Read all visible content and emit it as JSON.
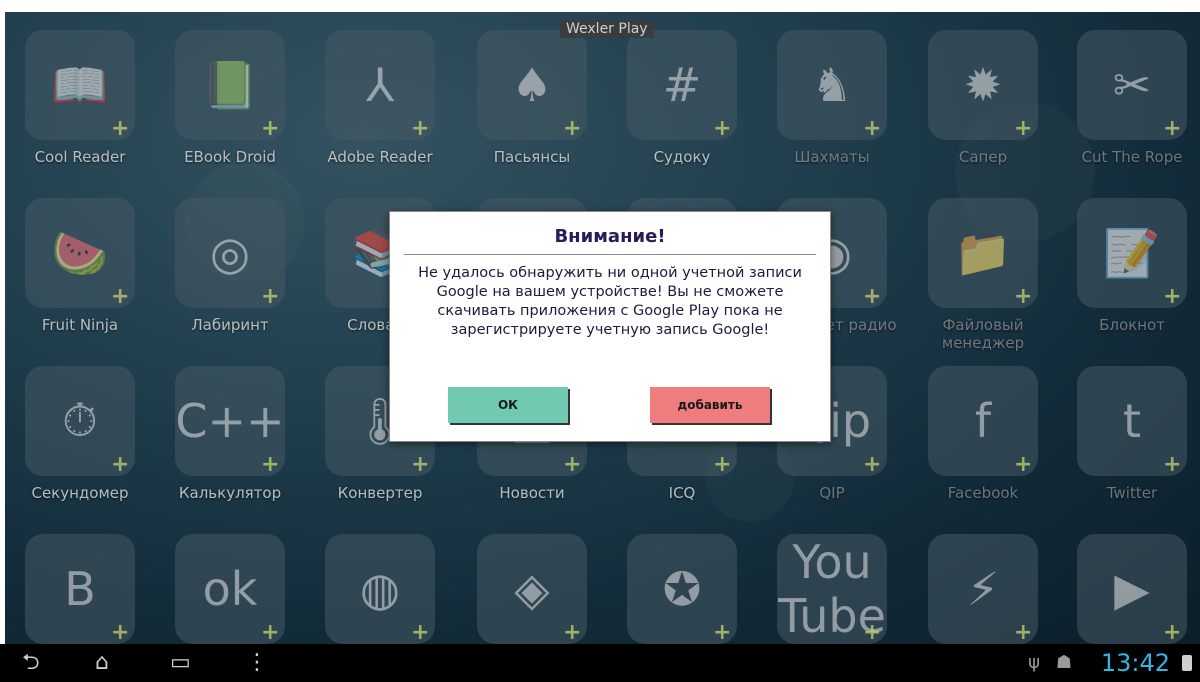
{
  "window": {
    "title": "Wexler Play"
  },
  "apps": [
    {
      "label": "Cool Reader",
      "glyph": "📖",
      "icon": "book-icon"
    },
    {
      "label": "EBook Droid",
      "glyph": "📗",
      "icon": "ebook-icon"
    },
    {
      "label": "Adobe Reader",
      "glyph": "⅄",
      "icon": "pdf-icon"
    },
    {
      "label": "Пасьянсы",
      "glyph": "♠",
      "icon": "cards-icon"
    },
    {
      "label": "Судоку",
      "glyph": "#",
      "icon": "sudoku-icon"
    },
    {
      "label": "Шахматы",
      "glyph": "♞",
      "icon": "chess-icon"
    },
    {
      "label": "Сапер",
      "glyph": "✹",
      "icon": "mine-icon"
    },
    {
      "label": "Cut The Rope",
      "glyph": "✂",
      "icon": "cut-rope-icon"
    },
    {
      "label": "Fruit Ninja",
      "glyph": "🍉",
      "icon": "fruit-ninja-icon"
    },
    {
      "label": "Лабиринт",
      "glyph": "◎",
      "icon": "labyrinth-icon"
    },
    {
      "label": "Словарь",
      "glyph": "📚",
      "icon": "dictionary-icon"
    },
    {
      "label": "",
      "glyph": "",
      "icon": "hidden-app-icon"
    },
    {
      "label": "",
      "glyph": "",
      "icon": "hidden-app-icon"
    },
    {
      "label": "Интернет радио",
      "glyph": "◉",
      "icon": "radio-icon"
    },
    {
      "label": "Файловый менеджер",
      "glyph": "📁",
      "icon": "folder-icon"
    },
    {
      "label": "Блокнот",
      "glyph": "📝",
      "icon": "notepad-icon"
    },
    {
      "label": "Секундомер",
      "glyph": "⏱",
      "icon": "stopwatch-icon"
    },
    {
      "label": "Калькулятор",
      "glyph": "C++",
      "icon": "calculator-icon"
    },
    {
      "label": "Конвертер",
      "glyph": "🌡",
      "icon": "thermometer-icon"
    },
    {
      "label": "Новости",
      "glyph": "▦",
      "icon": "news-icon"
    },
    {
      "label": "ICQ",
      "glyph": "✿",
      "icon": "icq-icon"
    },
    {
      "label": "QIP",
      "glyph": "Qip",
      "icon": "qip-icon"
    },
    {
      "label": "Facebook",
      "glyph": "f",
      "icon": "facebook-icon"
    },
    {
      "label": "Twitter",
      "glyph": "t",
      "icon": "twitter-icon"
    },
    {
      "label": "",
      "glyph": "B",
      "icon": "vk-icon"
    },
    {
      "label": "",
      "glyph": "ok",
      "icon": "odnoklassniki-icon"
    },
    {
      "label": "",
      "glyph": "◍",
      "icon": "browser-icon"
    },
    {
      "label": "",
      "glyph": "◈",
      "icon": "maps-icon"
    },
    {
      "label": "",
      "glyph": "✪",
      "icon": "navigator-icon"
    },
    {
      "label": "",
      "glyph": "You Tube",
      "icon": "youtube-icon"
    },
    {
      "label": "",
      "glyph": "⚡",
      "icon": "winamp-icon"
    },
    {
      "label": "",
      "glyph": "▶",
      "icon": "video-player-icon"
    }
  ],
  "dialog": {
    "title": "Внимание!",
    "message": "Не удалось обнаружить ни одной учетной записи Google на вашем устройстве! Вы не сможете скачивать приложения с Google Play пока не зарегистрируете учетную запись Google!",
    "ok_label": "ОК",
    "add_label": "добавить"
  },
  "navbar": {
    "back": "⮌",
    "home": "⌂",
    "recents": "▭",
    "menu": "⋮",
    "usb": "ψ",
    "android": "☗",
    "time": "13:42"
  }
}
